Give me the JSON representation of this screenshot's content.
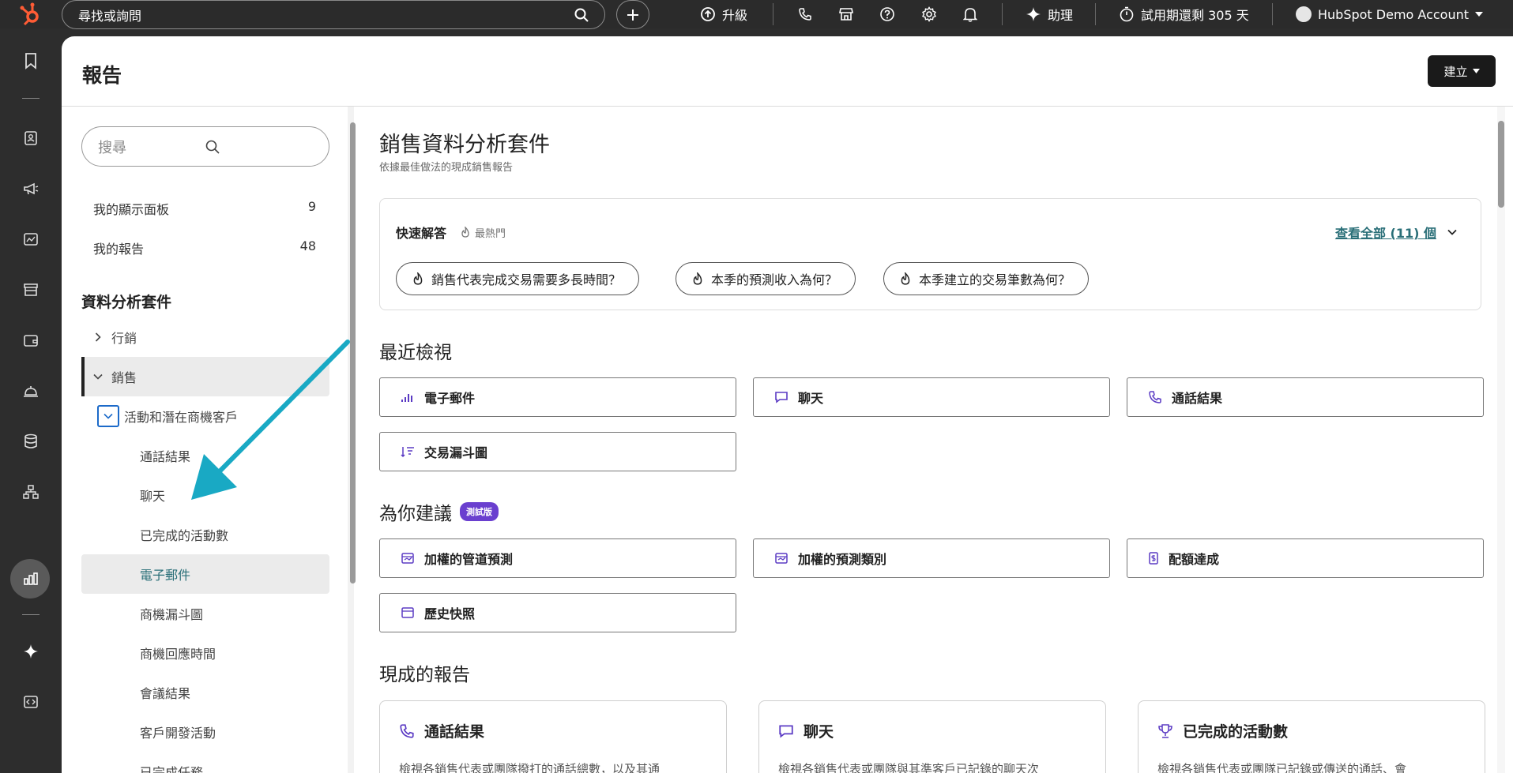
{
  "topbar": {
    "search_placeholder": "尋找或詢問",
    "upgrade_label": "升級",
    "assistant_label": "助理",
    "trial_label": "試用期還剩 305 天",
    "account_label": "HubSpot Demo Account"
  },
  "page": {
    "title": "報告",
    "create_label": "建立"
  },
  "sidebar": {
    "search_placeholder": "搜尋",
    "dashboards": {
      "label": "我的顯示面板",
      "count": "9"
    },
    "reports": {
      "label": "我的報告",
      "count": "48"
    },
    "section_title": "資料分析套件",
    "marketing_label": "行銷",
    "sales_label": "銷售",
    "subgroup_label": "活動和潛在商機客戶",
    "leaves": [
      {
        "label": "通話結果"
      },
      {
        "label": "聊天"
      },
      {
        "label": "已完成的活動數"
      },
      {
        "label": "電子郵件"
      },
      {
        "label": "商機漏斗圖"
      },
      {
        "label": "商機回應時間"
      },
      {
        "label": "會議結果"
      },
      {
        "label": "客戶開發活動"
      },
      {
        "label": "已完成任務"
      }
    ]
  },
  "content": {
    "title": "銷售資料分析套件",
    "subtitle": "依據最佳做法的現成銷售報告",
    "quick_answers": {
      "title": "快速解答",
      "popular_label": "最熱門",
      "view_all_label": "查看全部 (11) 個",
      "pills": [
        {
          "label": "銷售代表完成交易需要多長時間？"
        },
        {
          "label": "本季的預測收入為何？"
        },
        {
          "label": "本季建立的交易筆數為何？"
        }
      ]
    },
    "recent": {
      "title": "最近檢視",
      "tiles": [
        {
          "label": "電子郵件",
          "icon": "email-chart-icon"
        },
        {
          "label": "聊天",
          "icon": "chat-icon"
        },
        {
          "label": "通話結果",
          "icon": "call-icon"
        },
        {
          "label": "交易漏斗圖",
          "icon": "funnel-icon"
        }
      ]
    },
    "suggested": {
      "title": "為你建議",
      "badge": "測試版",
      "tiles": [
        {
          "label": "加權的管道預測",
          "icon": "forecast-icon"
        },
        {
          "label": "加權的預測類別",
          "icon": "forecast-icon"
        },
        {
          "label": "配額達成",
          "icon": "quota-icon"
        },
        {
          "label": "歷史快照",
          "icon": "calendar-icon"
        }
      ]
    },
    "ready": {
      "title": "現成的報告",
      "cards": [
        {
          "title": "通話結果",
          "desc": "檢視各銷售代表或團隊撥打的通話總數，以及其通",
          "icon": "call-icon"
        },
        {
          "title": "聊天",
          "desc": "檢視各銷售代表或團隊與其準客戶已記錄的聊天次",
          "icon": "chat-icon"
        },
        {
          "title": "已完成的活動數",
          "desc": "檢視各銷售代表或團隊已記錄或傳送的通話、會",
          "icon": "trophy-icon"
        }
      ]
    }
  },
  "colors": {
    "topbar_bg": "#2b2b2b",
    "accent_orange": "#ff5c35",
    "link_teal": "#2a6f78",
    "beta_purple": "#6a3fcf",
    "annotation_arrow": "#19a9c4",
    "icon_purple": "#5b3bc4"
  }
}
